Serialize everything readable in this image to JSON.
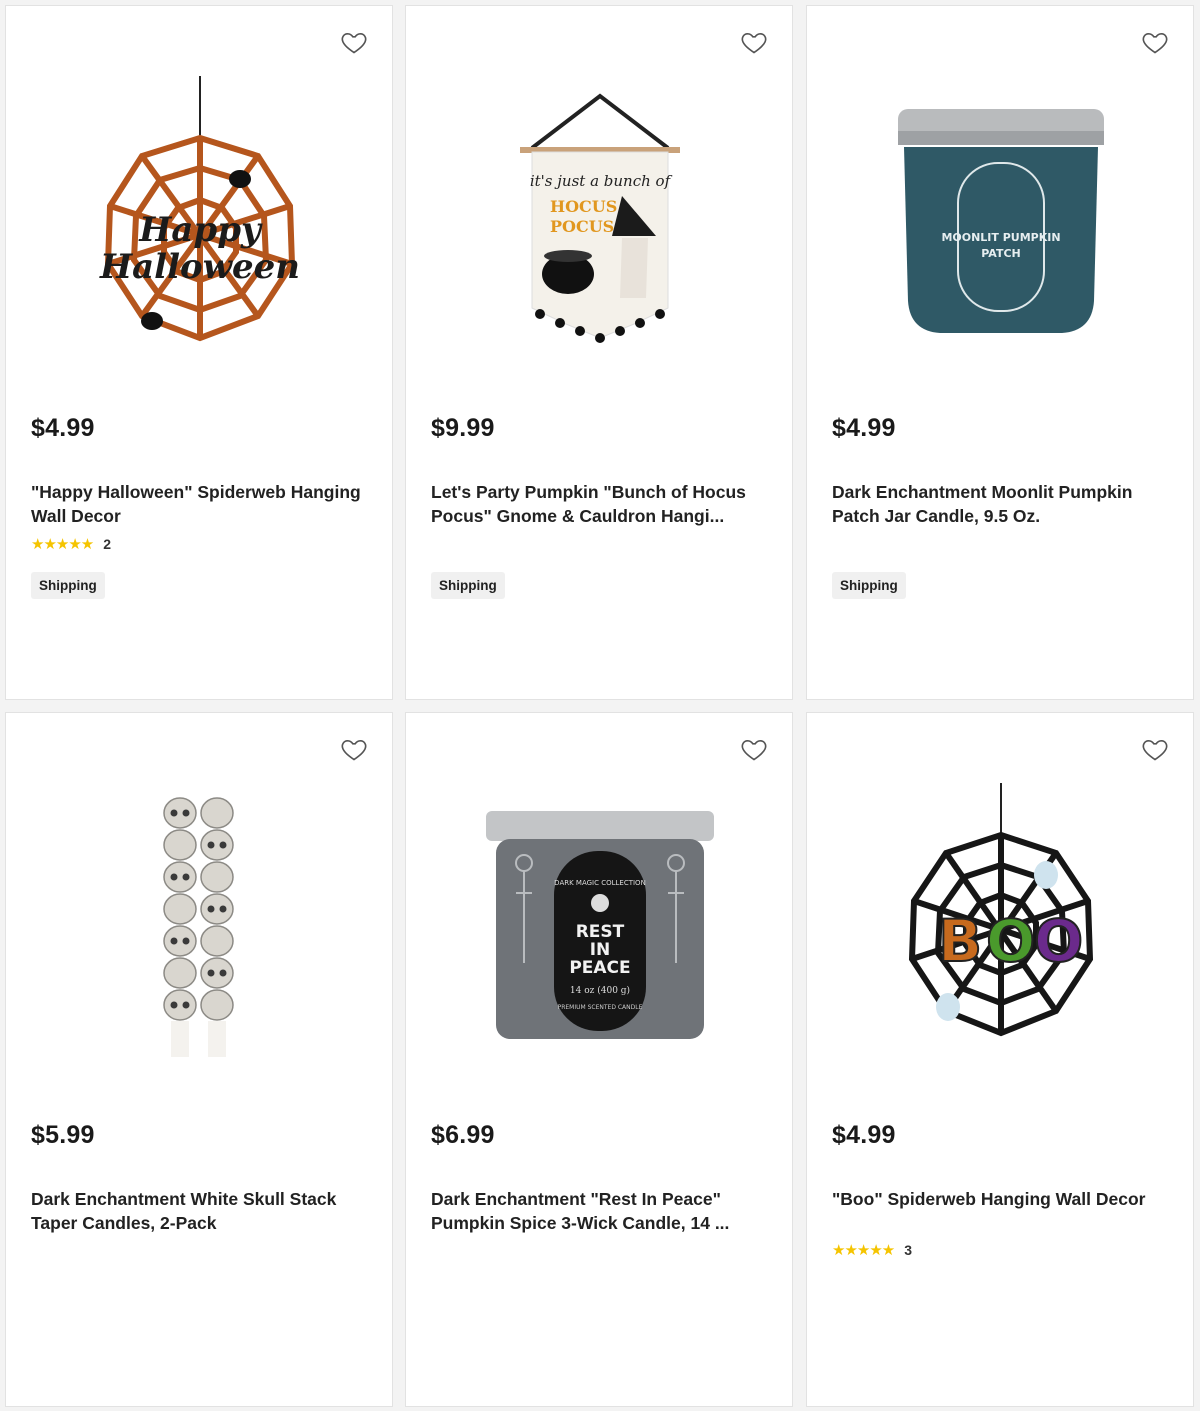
{
  "products": [
    {
      "price": "$4.99",
      "title": "\"Happy Halloween\" Spiderweb Hanging Wall Decor",
      "stars": "★★★★★",
      "rating_count": "2",
      "tag": "Shipping",
      "image": "orange-spiderweb-happy-halloween"
    },
    {
      "price": "$9.99",
      "title": "Let's Party Pumpkin \"Bunch of Hocus Pocus\" Gnome & Cauldron Hangi...",
      "tag": "Shipping",
      "image": "hocus-pocus-banner",
      "banner_text": [
        "it's just a bunch of",
        "HOCUS",
        "POCUS"
      ]
    },
    {
      "price": "$4.99",
      "title": "Dark Enchantment Moonlit Pumpkin Patch Jar Candle, 9.5 Oz.",
      "tag": "Shipping",
      "image": "teal-jar-candle",
      "label_text": [
        "MOONLIT PUMPKIN",
        "PATCH"
      ]
    },
    {
      "price": "$5.99",
      "title": "Dark Enchantment White Skull Stack Taper Candles, 2-Pack",
      "image": "skull-taper-candles"
    },
    {
      "price": "$6.99",
      "title": "Dark Enchantment \"Rest In Peace\" Pumpkin Spice 3-Wick Candle, 14 ...",
      "image": "rest-in-peace-candle",
      "label_text": [
        "DARK MAGIC COLLECTION",
        "REST",
        "IN",
        "PEACE",
        "14 oz (400 g)",
        "PREMIUM SCENTED CANDLE"
      ]
    },
    {
      "price": "$4.99",
      "title": "\"Boo\" Spiderweb Hanging Wall Decor",
      "stars": "★★★★★",
      "rating_count": "3",
      "image": "boo-spiderweb",
      "web_letters": [
        "B",
        "O",
        "O"
      ]
    }
  ],
  "colors": {
    "star": "#f5c400",
    "orange_web": "#b5561d",
    "teal_candle": "#2f5966",
    "gray_candle": "#6f7378"
  }
}
